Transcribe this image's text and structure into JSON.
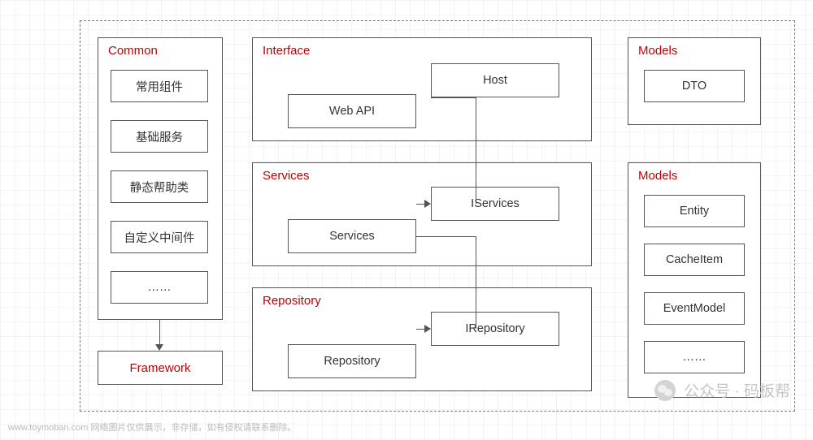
{
  "common": {
    "title": "Common",
    "items": [
      "常用组件",
      "基础服务",
      "静态帮助类",
      "自定义中间件",
      "……"
    ]
  },
  "framework": {
    "label": "Framework"
  },
  "interface": {
    "title": "Interface",
    "host": "Host",
    "webapi": "Web API"
  },
  "services": {
    "title": "Services",
    "iservices": "IServices",
    "services": "Services"
  },
  "repository": {
    "title": "Repository",
    "irepository": "IRepository",
    "repository": "Repository"
  },
  "models1": {
    "title": "Models",
    "dto": "DTO"
  },
  "models2": {
    "title": "Models",
    "items": [
      "Entity",
      "CacheItem",
      "EventModel",
      "……"
    ]
  },
  "watermark": {
    "site": "www.toymoban.com 网络图片仅供展示，非存储，如有侵权请联系删除。",
    "wechat": "公众号 · 码板帮"
  }
}
